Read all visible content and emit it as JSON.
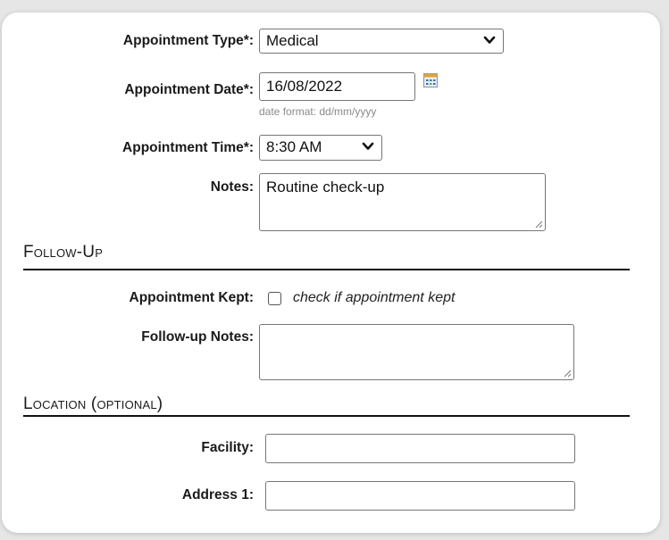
{
  "appointment": {
    "type_label": "Appointment Type*:",
    "type_value": "Medical",
    "date_label": "Appointment Date*:",
    "date_value": "16/08/2022",
    "date_hint": "date format: dd/mm/yyyy",
    "time_label": "Appointment Time*:",
    "time_value": "8:30 AM",
    "notes_label": "Notes:",
    "notes_value": "Routine check-up"
  },
  "follow_up": {
    "title": "Follow-Up",
    "kept_label": "Appointment Kept:",
    "kept_checked": false,
    "kept_caption": "check if appointment kept",
    "notes_label": "Follow-up Notes:",
    "notes_value": ""
  },
  "location": {
    "title": "Location",
    "title_suffix": "(optional)",
    "facility_label": "Facility:",
    "facility_value": "",
    "address1_label": "Address 1:",
    "address1_value": ""
  },
  "icons": {
    "calendar": "calendar-icon",
    "dropdown": "chevron-down-icon",
    "resize": "resize-grip-icon"
  }
}
